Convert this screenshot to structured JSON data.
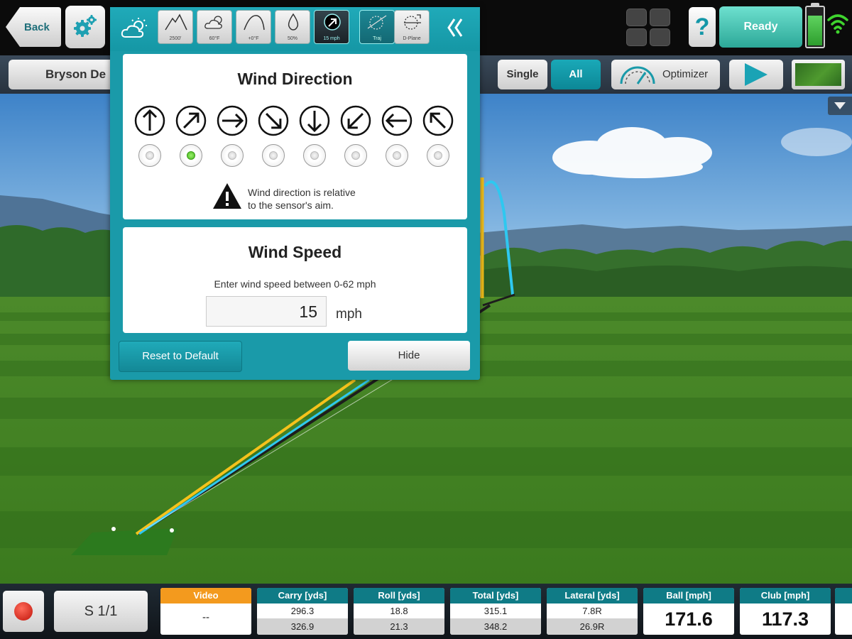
{
  "topbar": {
    "back_label": "Back",
    "help_label": "?",
    "ready_label": "Ready",
    "battery_level": 0.75
  },
  "bar2": {
    "player_name": "Bryson De",
    "single_label": "Single",
    "all_label": "All",
    "optimizer_label": "Optimizer"
  },
  "weather": {
    "tiles": [
      {
        "icon": "altitude-icon",
        "label": "2500'"
      },
      {
        "icon": "partly-cloudy-icon",
        "label": "60°F"
      },
      {
        "icon": "ball-temp-icon",
        "label": "+0°F"
      },
      {
        "icon": "humidity-icon",
        "label": "50%"
      },
      {
        "icon": "wind-icon",
        "label": "15 mph"
      },
      {
        "icon": "trajectory-icon",
        "label": "Traj"
      },
      {
        "icon": "d-plane-icon",
        "label": "D-Plane"
      }
    ],
    "direction": {
      "title": "Wind Direction",
      "arrows": [
        "arrow-up-icon",
        "arrow-up-right-icon",
        "arrow-right-icon",
        "arrow-down-right-icon",
        "arrow-down-icon",
        "arrow-down-left-icon",
        "arrow-left-icon",
        "arrow-up-left-icon"
      ],
      "selected_index": 1,
      "note_line1": "Wind direction is relative",
      "note_line2": "to the sensor's aim."
    },
    "speed": {
      "title": "Wind Speed",
      "hint": "Enter wind speed between 0-62 mph",
      "value": "15",
      "unit": "mph"
    },
    "reset_label": "Reset to Default",
    "hide_label": "Hide"
  },
  "stats": {
    "record_icon": "record-icon",
    "shot_label": "S 1/1",
    "video": {
      "header": "Video",
      "value": "--"
    },
    "carry": {
      "header": "Carry [yds]",
      "v1": "296.3",
      "v2": "326.9"
    },
    "roll": {
      "header": "Roll [yds]",
      "v1": "18.8",
      "v2": "21.3"
    },
    "total": {
      "header": "Total [yds]",
      "v1": "315.1",
      "v2": "348.2"
    },
    "lateral": {
      "header": "Lateral [yds]",
      "v1": "7.8R",
      "v2": "26.9R"
    },
    "ball": {
      "header": "Ball [mph]",
      "value": "171.6"
    },
    "club": {
      "header": "Club [mph]",
      "value": "117.3"
    }
  },
  "colors": {
    "accent": "#1a9aa9",
    "ready": "#3fbfae",
    "video_header": "#f39a1e",
    "stat_header": "#0f7b86",
    "tracer_yellow": "#f5c21b",
    "tracer_cyan": "#2ec8f0"
  }
}
